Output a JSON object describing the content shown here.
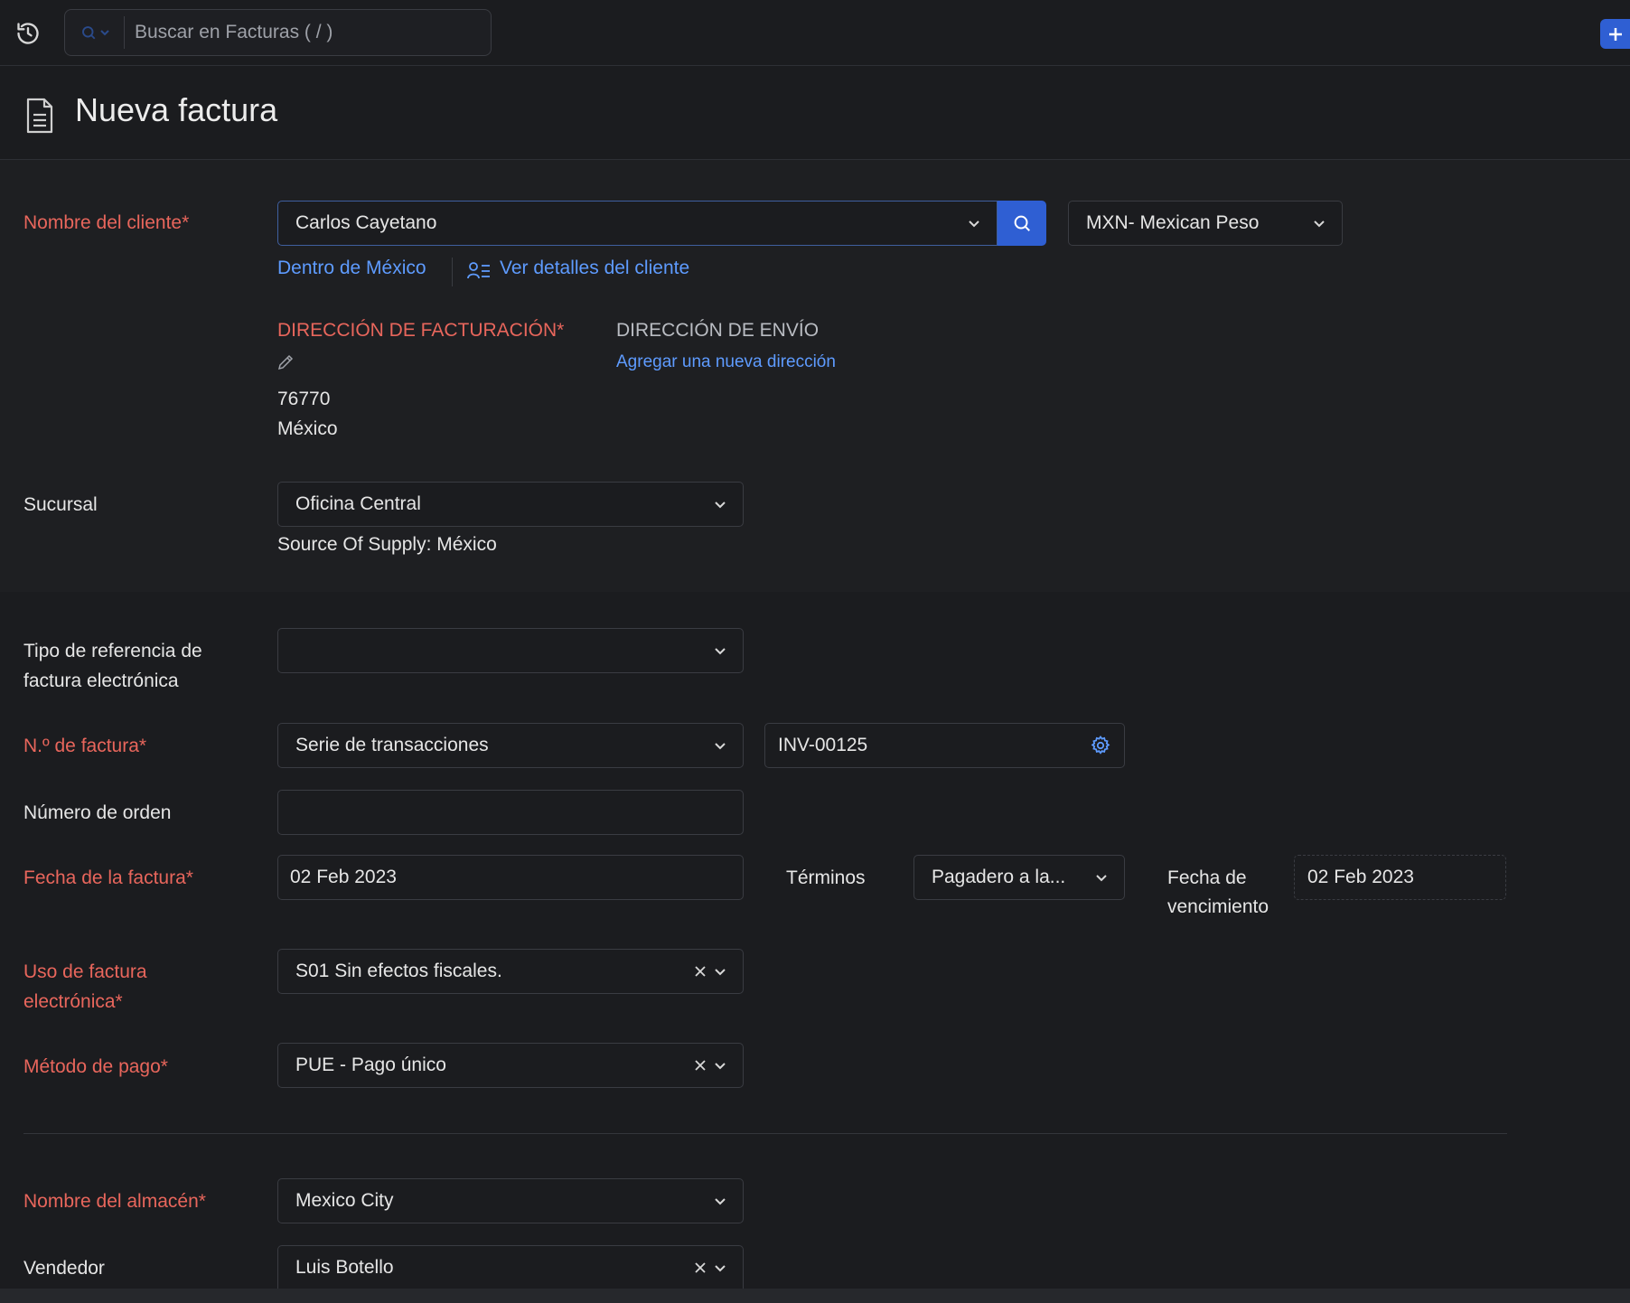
{
  "topbar": {
    "search_placeholder": "Buscar en Facturas ( / )"
  },
  "page": {
    "title": "Nueva factura"
  },
  "customer": {
    "label": "Nombre del cliente*",
    "value": "Carlos Cayetano",
    "currency": "MXN- Mexican Peso",
    "location_link": "Dentro de México",
    "details_link": "Ver detalles del cliente"
  },
  "billing_address": {
    "heading": "DIRECCIÓN DE FACTURACIÓN*",
    "line1": "76770",
    "line2": "México"
  },
  "shipping_address": {
    "heading": "DIRECCIÓN DE ENVÍO",
    "add_link": "Agregar una nueva dirección"
  },
  "branch": {
    "label": "Sucursal",
    "value": "Oficina Central",
    "source_of_supply": "Source Of Supply: México"
  },
  "e_invoice_ref": {
    "label_line1": "Tipo de referencia de",
    "label_line2": "factura electrónica",
    "value": ""
  },
  "invoice_number": {
    "label": "N.º de factura*",
    "series": "Serie de transacciones",
    "value": "INV-00125"
  },
  "order_number": {
    "label": "Número de orden",
    "value": ""
  },
  "invoice_date": {
    "label": "Fecha de la factura*",
    "value": "02 Feb 2023",
    "terms_label": "Términos",
    "terms_value": "Pagadero a la...",
    "due_label_line1": "Fecha de",
    "due_label_line2": "vencimiento",
    "due_value": "02 Feb 2023"
  },
  "e_invoice_use": {
    "label_line1": "Uso de factura",
    "label_line2": "electrónica*",
    "value": "S01 Sin efectos fiscales."
  },
  "payment_method": {
    "label": "Método de pago*",
    "value": "PUE - Pago único"
  },
  "warehouse": {
    "label": "Nombre del almacén*",
    "value": "Mexico City"
  },
  "salesperson": {
    "label": "Vendedor",
    "value": "Luis Botello"
  },
  "colors": {
    "accent": "#2f5fd3",
    "link": "#5e9bff",
    "required": "#e8665c",
    "background": "#1b1c1f"
  }
}
